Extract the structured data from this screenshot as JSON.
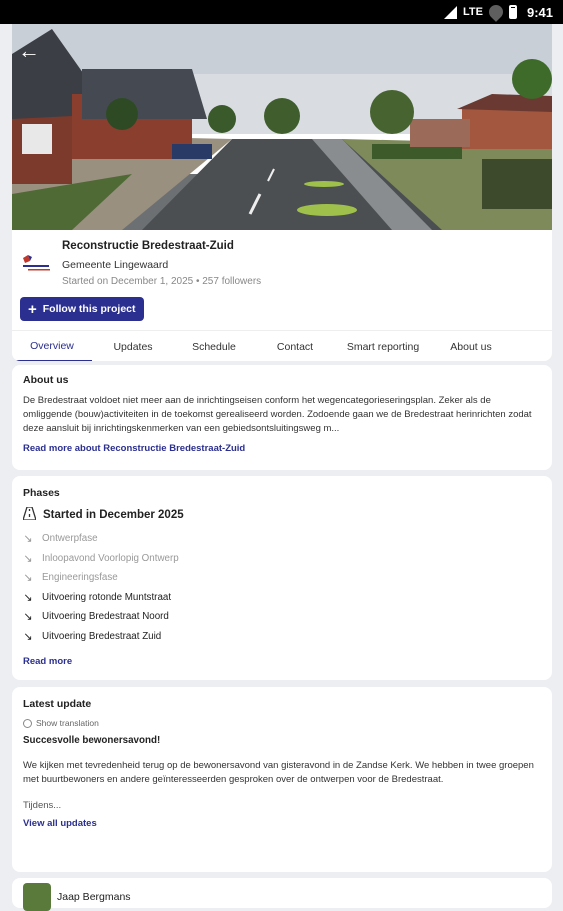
{
  "status_bar": {
    "network": "LTE",
    "time": "9:41"
  },
  "project": {
    "title": "Reconstructie Bredestraat-Zuid",
    "organization": "Gemeente Lingewaard",
    "meta": "Started on December 1, 2025 • 257 followers",
    "follow_label": "Follow this project"
  },
  "tabs": [
    {
      "label": "Overview",
      "active": true
    },
    {
      "label": "Updates"
    },
    {
      "label": "Schedule"
    },
    {
      "label": "Contact"
    },
    {
      "label": "Smart reporting"
    },
    {
      "label": "About us"
    }
  ],
  "about": {
    "heading": "About us",
    "text": "De Bredestraat voldoet niet meer aan de inrichtingseisen conform het wegencategorieseringsplan. Zeker als de omliggende (bouw)activiteiten in de toekomst gerealiseerd worden. Zodoende gaan we de Bredestraat herinrichten zodat deze aansluit bij inrichtingskenmerken van een gebiedsontsluitingsweg m...",
    "read_more": "Read more about Reconstructie Bredestraat-Zuid"
  },
  "phases": {
    "heading": "Phases",
    "current": "Started in December 2025",
    "items": [
      {
        "label": "Ontwerpfase",
        "state": "done"
      },
      {
        "label": "Inloopavond Voorlopig Ontwerp",
        "state": "done"
      },
      {
        "label": "Engineeringsfase",
        "state": "done"
      },
      {
        "label": "Uitvoering rotonde Muntstraat",
        "state": "todo"
      },
      {
        "label": "Uitvoering Bredestraat Noord",
        "state": "todo"
      },
      {
        "label": "Uitvoering Bredestraat Zuid",
        "state": "todo"
      }
    ],
    "read_more": "Read more"
  },
  "latest_update": {
    "heading": "Latest update",
    "translation": "Show translation",
    "title": "Succesvolle bewonersavond!",
    "body": "We kijken met tevredenheid terug op de bewonersavond van gisteravond in de Zandse Kerk. We hebben in twee groepen met buurtbewoners en andere geïnteresseerden gesproken over de ontwerpen voor de Bredestraat.",
    "more": "Tijdens...",
    "view_all": "View all updates"
  },
  "author": {
    "name": "Jaap Bergmans"
  }
}
